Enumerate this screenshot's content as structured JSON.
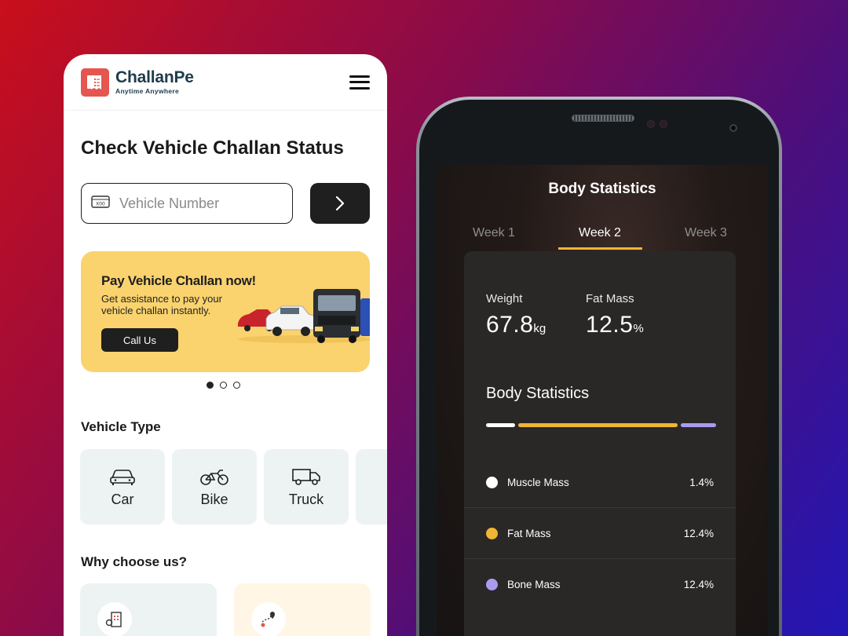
{
  "left_app": {
    "brand": {
      "name": "ChallanPe",
      "tagline": "Anytime Anywhere"
    },
    "page_title": "Check Vehicle Challan Status",
    "search": {
      "placeholder": "Vehicle Number",
      "value": ""
    },
    "promo": {
      "title": "Pay Vehicle Challan now!",
      "description": "Get assistance to pay your vehicle challan instantly.",
      "button": "Call Us"
    },
    "carousel": {
      "active": 1,
      "total": 3
    },
    "vehicle_type": {
      "title": "Vehicle Type",
      "items": [
        {
          "label": "Car",
          "icon": "car-icon"
        },
        {
          "label": "Bike",
          "icon": "bike-icon"
        },
        {
          "label": "Truck",
          "icon": "truck-icon"
        }
      ]
    },
    "why_choose": {
      "title": "Why choose us?",
      "icons": [
        "building-icon",
        "route-icon"
      ]
    }
  },
  "right_app": {
    "title": "Body Statistics",
    "weeks": [
      "Week 1",
      "Week 2",
      "Week 3"
    ],
    "active_week": "Week 2",
    "metrics": [
      {
        "label": "Weight",
        "value": "67.8",
        "unit": "kg"
      },
      {
        "label": "Fat Mass",
        "value": "12.5",
        "unit": "%"
      }
    ],
    "section_title": "Body Statistics",
    "stats": [
      {
        "name": "Muscle Mass",
        "value": "1.4%",
        "color": "#ffffff"
      },
      {
        "name": "Fat Mass",
        "value": "12.4%",
        "color": "#f0b534"
      },
      {
        "name": "Bone Mass",
        "value": "12.4%",
        "color": "#a99cf0"
      }
    ]
  },
  "colors": {
    "accent_yellow": "#f0b534",
    "accent_purple": "#a99cf0",
    "brand_red": "#e4564f",
    "promo_bg": "#fad36e"
  }
}
